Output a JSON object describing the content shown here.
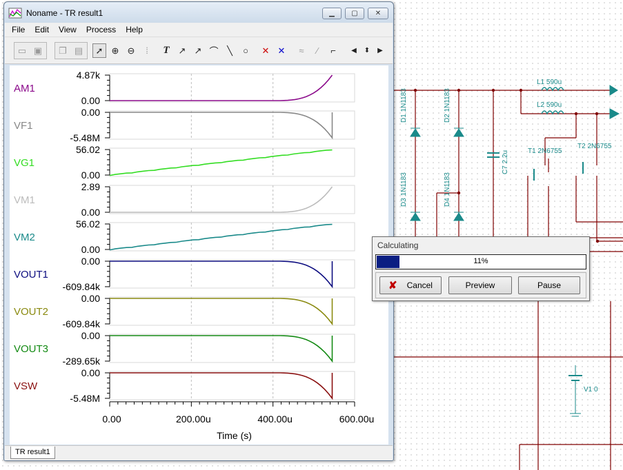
{
  "window": {
    "title": "Noname - TR result1"
  },
  "menu": [
    "File",
    "Edit",
    "View",
    "Process",
    "Help"
  ],
  "icons": {
    "app": "chart-app-icon",
    "minimize": "minimize-icon",
    "maximize": "maximize-icon",
    "close": "close-icon",
    "toolbar": [
      "open-icon",
      "save-icon",
      "copy-icon",
      "paste-icon",
      "pointer-icon",
      "zoom-in-icon",
      "zoom-100-icon",
      "grid-icon",
      "text-icon",
      "label-curve-icon",
      "label-point-icon",
      "label-axis-icon",
      "line-icon",
      "circle-icon",
      "cursor-a-icon",
      "cursor-b-icon",
      "wave-icon",
      "probe-icon",
      "step-icon",
      "scroll-left-icon",
      "scroll-updown-icon",
      "scroll-right-icon"
    ]
  },
  "chart_data": {
    "type": "line",
    "xlabel": "Time (s)",
    "xlim": [
      0,
      0.0006
    ],
    "x_tick_labels": [
      "0.00",
      "200.00u",
      "400.00u",
      "600.00u"
    ],
    "grid": true,
    "series": [
      {
        "name": "AM1",
        "color": "#8b0a8b",
        "y_top_label": "4.87k",
        "y_bottom_label": "0.00",
        "shape": "rise-late",
        "x": [
          0,
          0.0004,
          0.00045,
          0.0005,
          0.00052,
          0.000545
        ],
        "y": [
          0,
          0,
          60,
          700,
          1800,
          4870
        ]
      },
      {
        "name": "VF1",
        "color": "#888888",
        "y_top_label": "0.00",
        "y_bottom_label": "-5.48M",
        "shape": "fall-late",
        "x": [
          0,
          0.0004,
          0.00045,
          0.0005,
          0.00052,
          0.000545
        ],
        "y": [
          0,
          0,
          -70000,
          -700000,
          -2000000,
          -5480000
        ]
      },
      {
        "name": "VG1",
        "color": "#33dd22",
        "y_top_label": "56.02",
        "y_bottom_label": "0.00",
        "shape": "ramp",
        "x": [
          0,
          0.000545
        ],
        "y": [
          0,
          56.02
        ]
      },
      {
        "name": "VM1",
        "color": "#bcbcbc",
        "y_top_label": "2.89",
        "y_bottom_label": "0.00",
        "shape": "rise-late",
        "x": [
          0,
          0.0004,
          0.00045,
          0.0005,
          0.00052,
          0.000545
        ],
        "y": [
          0,
          0,
          0.04,
          0.4,
          1.1,
          2.89
        ]
      },
      {
        "name": "VM2",
        "color": "#1a8a8a",
        "y_top_label": "56.02",
        "y_bottom_label": "0.00",
        "shape": "ramp",
        "x": [
          0,
          0.000545
        ],
        "y": [
          0,
          56.02
        ]
      },
      {
        "name": "VOUT1",
        "color": "#0d0d80",
        "y_top_label": "0.00",
        "y_bottom_label": "-609.84k",
        "shape": "fall-late",
        "x": [
          0,
          0.0004,
          0.00045,
          0.0005,
          0.00052,
          0.000545
        ],
        "y": [
          0,
          0,
          -8000,
          -80000,
          -230000,
          -609840
        ]
      },
      {
        "name": "VOUT2",
        "color": "#8a8a10",
        "y_top_label": "0.00",
        "y_bottom_label": "-609.84k",
        "shape": "fall-late",
        "x": [
          0,
          0.0004,
          0.00045,
          0.0005,
          0.00052,
          0.000545
        ],
        "y": [
          0,
          0,
          -8000,
          -80000,
          -230000,
          -609840
        ]
      },
      {
        "name": "VOUT3",
        "color": "#138a13",
        "y_top_label": "0.00",
        "y_bottom_label": "-289.65k",
        "shape": "fall-late",
        "x": [
          0,
          0.0004,
          0.00045,
          0.0005,
          0.00052,
          0.000545
        ],
        "y": [
          0,
          0,
          -4000,
          -38000,
          -110000,
          -289650
        ]
      },
      {
        "name": "VSW",
        "color": "#8a1010",
        "y_top_label": "0.00",
        "y_bottom_label": "-5.48M",
        "shape": "fall-late",
        "x": [
          0,
          0.0004,
          0.00045,
          0.0005,
          0.00052,
          0.000545
        ],
        "y": [
          0,
          0,
          -70000,
          -700000,
          -2000000,
          -5480000
        ]
      }
    ]
  },
  "tab_label": "TR result1",
  "dialog": {
    "title": "Calculating",
    "progress_percent": 11,
    "progress_text": "11%",
    "cancel_label": "Cancel",
    "preview_label": "Preview",
    "pause_label": "Pause"
  },
  "schematic_labels": {
    "d1": "D1 1N1183",
    "d2": "D2 1N1183",
    "d3": "D3 1N1183",
    "d4": "D4 1N1183",
    "c7": "C7 2.2u",
    "l1": "L1 590u",
    "l2": "L2 590u",
    "t1": "T1 2N6755",
    "t2": "T2 2N6755",
    "v1": "V1 0"
  },
  "colors": {
    "wire": "#800000",
    "component": "#1a8a8a",
    "progress": "#0a1e82"
  }
}
